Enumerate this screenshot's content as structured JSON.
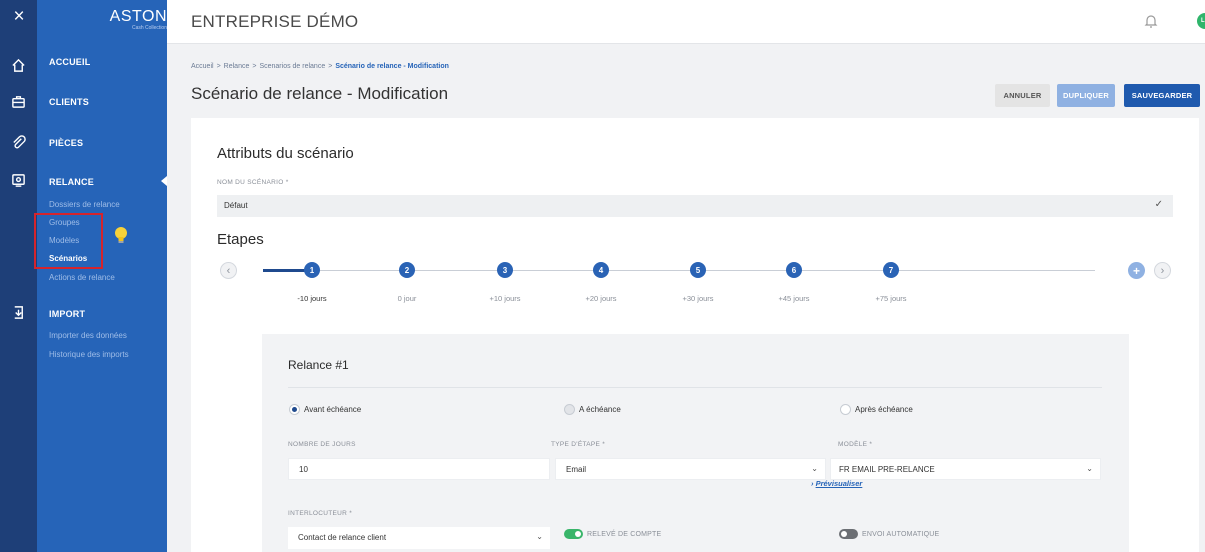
{
  "rail": {
    "icons": [
      "close-icon",
      "home-icon",
      "briefcase-icon",
      "paperclip-icon",
      "relance-icon",
      "import-icon"
    ]
  },
  "sidebar": {
    "logo": "ASTON",
    "logo_sub": "Cash Collection",
    "nav": [
      {
        "label": "ACCUEIL"
      },
      {
        "label": "CLIENTS"
      },
      {
        "label": "PIÈCES"
      },
      {
        "label": "RELANCE"
      },
      {
        "label": "IMPORT"
      }
    ],
    "relance_sub": [
      {
        "label": "Dossiers de relance"
      },
      {
        "label": "Groupes"
      },
      {
        "label": "Modèles"
      },
      {
        "label": "Scénarios"
      },
      {
        "label": "Actions de relance"
      }
    ],
    "import_sub": [
      {
        "label": "Importer des données"
      },
      {
        "label": "Historique des imports"
      }
    ]
  },
  "header": {
    "company": "ENTREPRISE DÉMO",
    "avatar_initials": "LK"
  },
  "breadcrumb": {
    "items": [
      "Accueil",
      "Relance",
      "Scenarios de relance",
      "Scénario de relance - Modification"
    ],
    "sep": ">"
  },
  "page": {
    "title": "Scénario de relance - Modification",
    "cancel_label": "ANNULER",
    "duplicate_label": "DUPLIQUER",
    "save_label": "SAUVEGARDER"
  },
  "attributes": {
    "section_title": "Attributs du scénario",
    "name_label": "NOM DU SCÉNARIO *",
    "name_value": "Défaut"
  },
  "steps": {
    "section_title": "Etapes",
    "items": [
      {
        "num": "1",
        "label": "-10 jours"
      },
      {
        "num": "2",
        "label": "0 jour"
      },
      {
        "num": "3",
        "label": "+10 jours"
      },
      {
        "num": "4",
        "label": "+20 jours"
      },
      {
        "num": "5",
        "label": "+30 jours"
      },
      {
        "num": "6",
        "label": "+45 jours"
      },
      {
        "num": "7",
        "label": "+75 jours"
      }
    ],
    "add_label": "+"
  },
  "relance": {
    "title": "Relance #1",
    "radio_before": "Avant échéance",
    "radio_at": "A échéance",
    "radio_after": "Après échéance",
    "days_label": "NOMBRE DE JOURS",
    "days_value": "10",
    "type_label": "TYPE D'ÉTAPE *",
    "type_value": "Email",
    "model_label": "MODÈLE *",
    "model_value": "FR EMAIL PRE-RELANCE",
    "preview_label": "Prévisualiser",
    "contact_label": "INTERLOCUTEUR *",
    "contact_value": "Contact de relance client",
    "statement_label": "RELEVÉ DE COMPTE",
    "auto_label": "ENVOI AUTOMATIQUE",
    "statement_on": true,
    "auto_on": false
  }
}
